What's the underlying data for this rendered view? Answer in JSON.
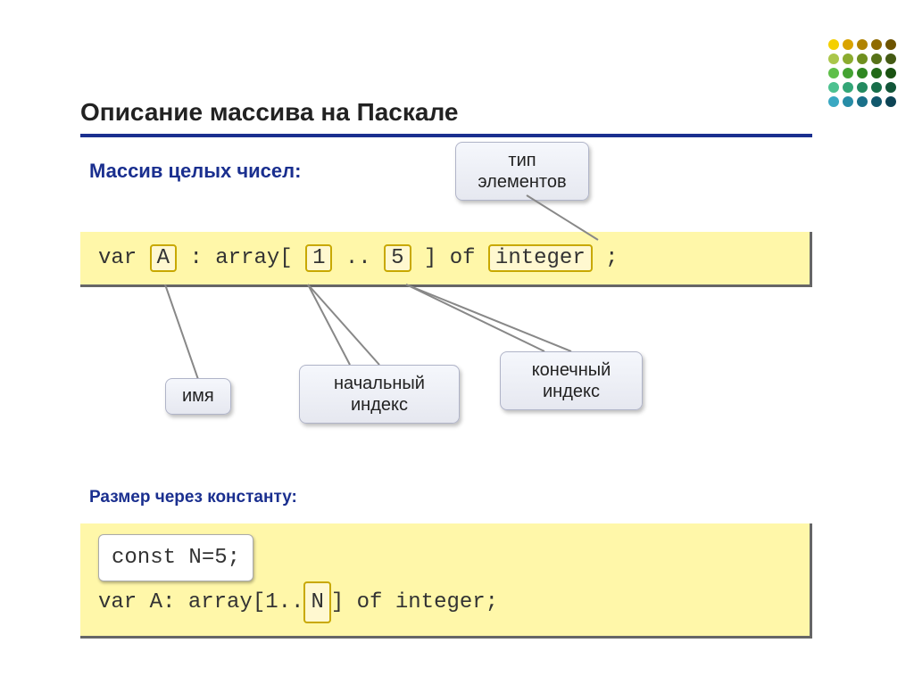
{
  "title": "Описание массива на Паскале",
  "subtitle": "Массив целых чисел:",
  "code1": {
    "var": "var",
    "name": "A",
    "colon_array": ": array[",
    "idx_start": "1",
    "dots": " .. ",
    "idx_end": "5",
    "bracket_of": " ] of ",
    "type": "integer",
    "semi": " ;"
  },
  "callouts": {
    "type_label": "тип\nэлементов",
    "end_index": "конечный\nиндекс",
    "start_index": "начальный\nиндекс",
    "name_label": "имя"
  },
  "subtitle2": "Размер через константу:",
  "code2": {
    "const_line": "const N=5;",
    "var_pre": "var A: array[1..",
    "n": "N",
    "var_post": "] of integer;"
  },
  "dot_colors": [
    "#f4d000",
    "#d9a300",
    "#b08300",
    "#8f6a00",
    "#6e5400",
    "#aac64a",
    "#8bab2f",
    "#6f8f1f",
    "#577218",
    "#445a13",
    "#5fbf4a",
    "#44a333",
    "#308722",
    "#236a18",
    "#1a5212",
    "#4dc190",
    "#33a677",
    "#238a60",
    "#186e4a",
    "#125639",
    "#3aa8c2",
    "#278ca6",
    "#1a7089",
    "#12586c",
    "#0d4455"
  ]
}
